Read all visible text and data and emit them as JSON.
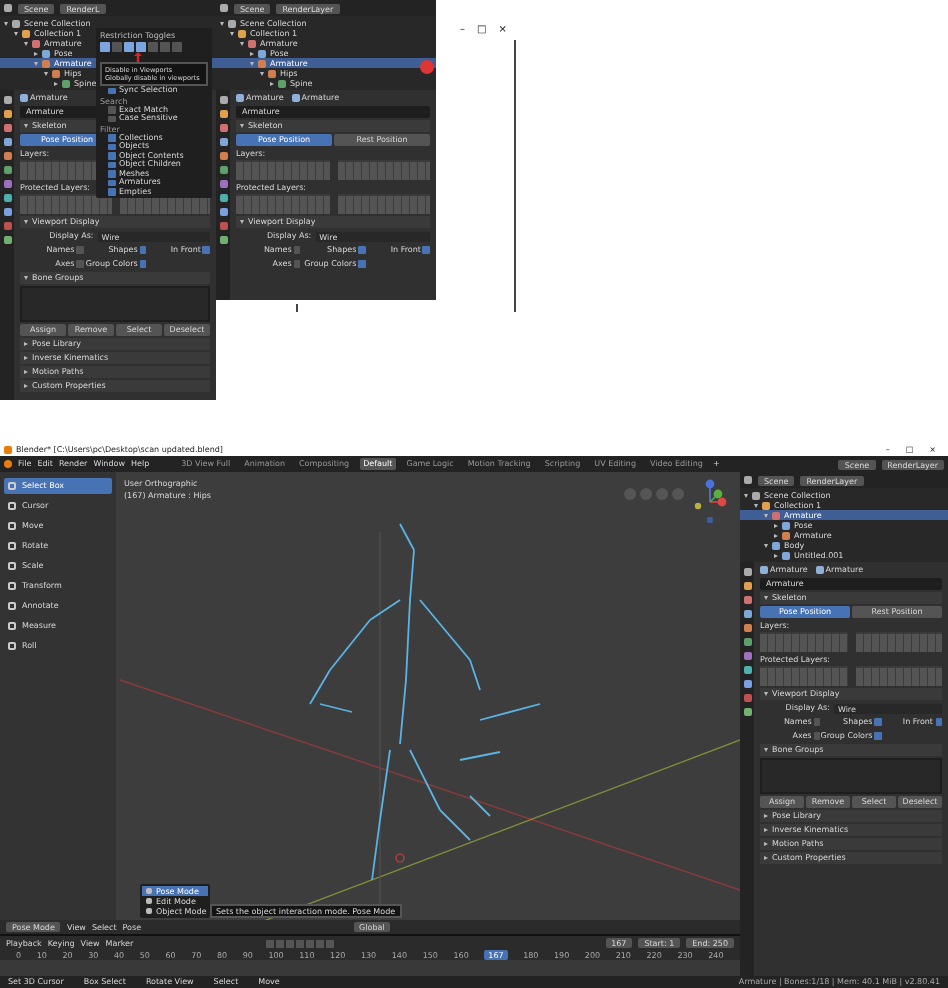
{
  "top_left_panel": {
    "header": {
      "scene": "Scene",
      "view_layer": "RenderL"
    },
    "outliner": [
      {
        "label": "Scene Collection",
        "expanded": true,
        "selected": false,
        "children": [
          {
            "label": "Collection 1",
            "expanded": true,
            "selected": false,
            "children": [
              {
                "label": "Armature",
                "expanded": true,
                "selected": false,
                "children": [
                  {
                    "label": "Pose",
                    "expanded": false,
                    "selected": false
                  },
                  {
                    "label": "Armature",
                    "expanded": true,
                    "selected": true,
                    "children": [
                      {
                        "label": "Hips",
                        "expanded": true,
                        "selected": false,
                        "children": [
                          {
                            "label": "Spine",
                            "expanded": false,
                            "selected": false
                          }
                        ]
                      }
                    ]
                  }
                ]
              }
            ]
          }
        ]
      }
    ],
    "properties": [
      {
        "kind": "breadcrumb",
        "items": [
          "Armature"
        ]
      },
      {
        "kind": "name_field",
        "value": "Armature"
      },
      {
        "kind": "section",
        "label": "Skeleton",
        "expanded": true
      },
      {
        "kind": "toggle_pair",
        "options": [
          {
            "label": "Pose Position",
            "selected": true
          }
        ]
      },
      {
        "kind": "label",
        "text": "Layers:"
      },
      {
        "kind": "layer_grid_left"
      },
      {
        "kind": "label",
        "text": "Protected Layers:"
      },
      {
        "kind": "layer_grid"
      },
      {
        "kind": "section",
        "label": "Viewport Display",
        "expanded": true
      },
      {
        "kind": "dropdown",
        "label": "Display As:",
        "value": "Wire"
      },
      {
        "kind": "checks",
        "items": [
          {
            "label": "Names",
            "checked": false
          },
          {
            "label": "Shapes",
            "checked": true
          },
          {
            "label": "In Front",
            "checked": true
          }
        ]
      },
      {
        "kind": "checks",
        "items": [
          {
            "label": "Axes",
            "checked": false
          },
          {
            "label": "Group Colors",
            "checked": true
          }
        ]
      },
      {
        "kind": "section",
        "label": "Bone Groups",
        "expanded": true
      },
      {
        "kind": "list_box"
      },
      {
        "kind": "buttons",
        "items": [
          "Assign",
          "Remove",
          "Select",
          "Deselect"
        ]
      },
      {
        "kind": "section",
        "label": "Pose Library",
        "expanded": false
      },
      {
        "kind": "section",
        "label": "Inverse Kinematics",
        "expanded": false
      },
      {
        "kind": "section",
        "label": "Motion Paths",
        "expanded": false
      },
      {
        "kind": "section",
        "label": "Custom Properties",
        "expanded": false
      }
    ],
    "popover": {
      "title": "Restriction Toggles",
      "toggles": [
        {
          "on": true
        },
        {
          "on": false
        },
        {
          "on": true
        },
        {
          "on": true
        },
        {
          "on": false
        },
        {
          "on": false
        },
        {
          "on": false
        }
      ],
      "tooltip": [
        "Disable in Viewports",
        "Globally disable in viewports"
      ],
      "items": [
        {
          "kind": "check",
          "label": "Sync Selection",
          "checked": true
        },
        {
          "kind": "heading",
          "label": "Search"
        },
        {
          "kind": "check",
          "label": "Exact Match",
          "checked": false
        },
        {
          "kind": "check",
          "label": "Case Sensitive",
          "checked": false
        },
        {
          "kind": "heading",
          "label": "Filter"
        },
        {
          "kind": "check",
          "label": "Collections",
          "checked": true
        },
        {
          "kind": "check",
          "label": "Objects",
          "checked": true
        },
        {
          "kind": "check",
          "label": "Object Contents",
          "checked": true
        },
        {
          "kind": "check",
          "label": "Object Children",
          "checked": true
        },
        {
          "kind": "check",
          "label": "Meshes",
          "checked": true
        },
        {
          "kind": "check",
          "label": "Armatures",
          "checked": true
        },
        {
          "kind": "check",
          "label": "Empties",
          "checked": true
        }
      ]
    }
  },
  "top_middle_panel": {
    "header": {
      "scene": "Scene",
      "view_layer": "RenderLayer"
    },
    "outliner": [
      {
        "label": "Scene Collection",
        "expanded": true,
        "selected": false,
        "children": [
          {
            "label": "Collection 1",
            "expanded": true,
            "selected": false,
            "children": [
              {
                "label": "Armature",
                "expanded": true,
                "selected": false,
                "children": [
                  {
                    "label": "Pose",
                    "expanded": false,
                    "selected": false
                  },
                  {
                    "label": "Armature",
                    "expanded": true,
                    "selected": true,
                    "children": [
                      {
                        "label": "Hips",
                        "expanded": true,
                        "selected": false,
                        "children": [
                          {
                            "label": "Spine",
                            "expanded": false,
                            "selected": false
                          }
                        ]
                      }
                    ]
                  }
                ]
              }
            ]
          }
        ]
      }
    ],
    "properties": [
      {
        "kind": "breadcrumb",
        "items": [
          "Armature",
          "Armature"
        ]
      },
      {
        "kind": "name_field",
        "value": "Armature"
      },
      {
        "kind": "section",
        "label": "Skeleton",
        "expanded": true
      },
      {
        "kind": "toggle_pair",
        "options": [
          {
            "label": "Pose Position",
            "selected": true
          },
          {
            "label": "Rest Position",
            "selected": false
          }
        ]
      },
      {
        "kind": "label",
        "text": "Layers:"
      },
      {
        "kind": "layer_grid"
      },
      {
        "kind": "label",
        "text": "Protected Layers:"
      },
      {
        "kind": "layer_grid"
      },
      {
        "kind": "section",
        "label": "Viewport Display",
        "expanded": true
      },
      {
        "kind": "dropdown",
        "label": "Display As:",
        "value": "Wire"
      },
      {
        "kind": "checks",
        "items": [
          {
            "label": "Names",
            "checked": false
          },
          {
            "label": "Shapes",
            "checked": true
          },
          {
            "label": "In Front",
            "checked": true
          }
        ]
      },
      {
        "kind": "checks",
        "items": [
          {
            "label": "Axes",
            "checked": false
          },
          {
            "label": "Group Colors",
            "checked": true
          }
        ]
      }
    ]
  },
  "window_controls": [
    "–",
    "□",
    "×"
  ],
  "blender_window": {
    "title": "Blender* [C:\\Users\\pc\\Desktop\\scan updated.blend]",
    "title_controls": [
      "–",
      "□",
      "×"
    ],
    "menu": [
      "File",
      "Edit",
      "Render",
      "Window",
      "Help"
    ],
    "workspaces": [
      {
        "label": "3D View Full",
        "selected": false
      },
      {
        "label": "Animation",
        "selected": false
      },
      {
        "label": "Compositing",
        "selected": false
      },
      {
        "label": "Default",
        "selected": true
      },
      {
        "label": "Game Logic",
        "selected": false
      },
      {
        "label": "Motion Tracking",
        "selected": false
      },
      {
        "label": "Scripting",
        "selected": false
      },
      {
        "label": "UV Editing",
        "selected": false
      },
      {
        "label": "Video Editing",
        "selected": false
      }
    ],
    "add_workspace": "+",
    "scene": "Scene",
    "view_layer": "RenderLayer",
    "tools": [
      {
        "label": "Select Box",
        "selected": true
      },
      {
        "label": "Cursor",
        "selected": false
      },
      {
        "label": "Move",
        "selected": false
      },
      {
        "label": "Rotate",
        "selected": false
      },
      {
        "label": "Scale",
        "selected": false
      },
      {
        "label": "Transform",
        "selected": false
      },
      {
        "label": "Annotate",
        "selected": false
      },
      {
        "label": "Measure",
        "selected": false
      },
      {
        "label": "Roll",
        "selected": false
      }
    ],
    "viewport": {
      "view_name": "User Orthographic",
      "context": "(167) Armature : Hips"
    },
    "mode_menu": {
      "items": [
        {
          "label": "Pose Mode",
          "selected": true
        },
        {
          "label": "Edit Mode",
          "selected": false
        },
        {
          "label": "Object Mode",
          "selected": false
        }
      ],
      "tooltip": "Sets the object interaction mode.  Pose Mode"
    },
    "viewport_header": {
      "mode": "Pose Mode",
      "menus": [
        "View",
        "Select",
        "Pose"
      ],
      "pivot": "Global"
    },
    "timeline_header": {
      "menus": [
        "Playback",
        "Keying",
        "View",
        "Marker"
      ],
      "fields": [
        "167",
        "Start: 1",
        "End: 250"
      ]
    },
    "ruler": [
      {
        "label": "0",
        "selected": false
      },
      {
        "label": "10",
        "selected": false
      },
      {
        "label": "20",
        "selected": false
      },
      {
        "label": "30",
        "selected": false
      },
      {
        "label": "40",
        "selected": false
      },
      {
        "label": "50",
        "selected": false
      },
      {
        "label": "60",
        "selected": false
      },
      {
        "label": "70",
        "selected": false
      },
      {
        "label": "80",
        "selected": false
      },
      {
        "label": "90",
        "selected": false
      },
      {
        "label": "100",
        "selected": false
      },
      {
        "label": "110",
        "selected": false
      },
      {
        "label": "120",
        "selected": false
      },
      {
        "label": "130",
        "selected": false
      },
      {
        "label": "140",
        "selected": false
      },
      {
        "label": "150",
        "selected": false
      },
      {
        "label": "160",
        "selected": false
      },
      {
        "label": "167",
        "selected": true
      },
      {
        "label": "180",
        "selected": false
      },
      {
        "label": "190",
        "selected": false
      },
      {
        "label": "200",
        "selected": false
      },
      {
        "label": "210",
        "selected": false
      },
      {
        "label": "220",
        "selected": false
      },
      {
        "label": "230",
        "selected": false
      },
      {
        "label": "240",
        "selected": false
      }
    ],
    "status": [
      "Set 3D Cursor",
      "Box Select",
      "Rotate View",
      "Select",
      "Move"
    ],
    "stats": "Armature | Bones:1/18 | Mem: 40.1 MiB | v2.80.41",
    "side_panel": {
      "header": {
        "scene": "Scene",
        "view_layer": "RenderLayer"
      },
      "outliner": [
        {
          "label": "Scene Collection",
          "expanded": true,
          "selected": false,
          "children": [
            {
              "label": "Collection 1",
              "expanded": true,
              "selected": false,
              "children": [
                {
                  "label": "Armature",
                  "expanded": true,
                  "selected": true,
                  "children": [
                    {
                      "label": "Pose",
                      "expanded": false,
                      "selected": false
                    },
                    {
                      "label": "Armature",
                      "expanded": false,
                      "selected": false
                    }
                  ]
                },
                {
                  "label": "Body",
                  "expanded": true,
                  "selected": false,
                  "children": [
                    {
                      "label": "Untitled.001",
                      "expanded": false,
                      "selected": false
                    }
                  ]
                }
              ]
            }
          ]
        }
      ],
      "properties": [
        {
          "kind": "breadcrumb",
          "items": [
            "Armature",
            "Armature"
          ]
        },
        {
          "kind": "name_field",
          "value": "Armature"
        },
        {
          "kind": "section",
          "label": "Skeleton",
          "expanded": true
        },
        {
          "kind": "toggle_pair",
          "options": [
            {
              "label": "Pose Position",
              "selected": true
            },
            {
              "label": "Rest Position",
              "selected": false
            }
          ]
        },
        {
          "kind": "label",
          "text": "Layers:"
        },
        {
          "kind": "layer_grid"
        },
        {
          "kind": "label",
          "text": "Protected Layers:"
        },
        {
          "kind": "layer_grid"
        },
        {
          "kind": "section",
          "label": "Viewport Display",
          "expanded": true
        },
        {
          "kind": "dropdown",
          "label": "Display As:",
          "value": "Wire"
        },
        {
          "kind": "checks",
          "items": [
            {
              "label": "Names",
              "checked": false
            },
            {
              "label": "Shapes",
              "checked": true
            },
            {
              "label": "In Front",
              "checked": true
            }
          ]
        },
        {
          "kind": "checks",
          "items": [
            {
              "label": "Axes",
              "checked": false
            },
            {
              "label": "Group Colors",
              "checked": true
            }
          ]
        },
        {
          "kind": "section",
          "label": "Bone Groups",
          "expanded": true
        },
        {
          "kind": "list_box"
        },
        {
          "kind": "buttons",
          "items": [
            "Assign",
            "Remove",
            "Select",
            "Deselect"
          ]
        },
        {
          "kind": "section",
          "label": "Pose Library",
          "expanded": false
        },
        {
          "kind": "section",
          "label": "Inverse Kinematics",
          "expanded": false
        },
        {
          "kind": "section",
          "label": "Motion Paths",
          "expanded": false
        },
        {
          "kind": "section",
          "label": "Custom Properties",
          "expanded": false
        }
      ]
    }
  }
}
